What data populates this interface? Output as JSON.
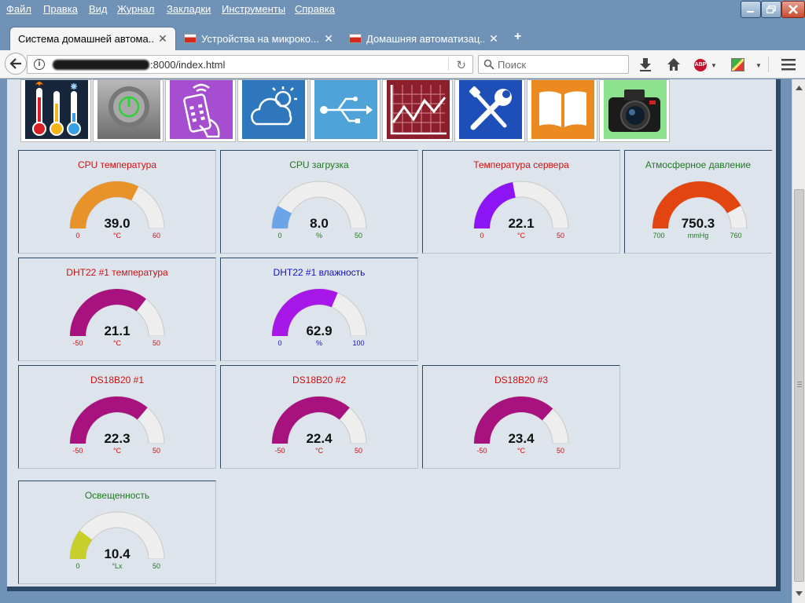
{
  "menubar": {
    "items": [
      "Файл",
      "Правка",
      "Вид",
      "Журнал",
      "Закладки",
      "Инструменты",
      "Справка"
    ]
  },
  "tabs": [
    {
      "label": "Система домашней автома...",
      "active": true
    },
    {
      "label": "Устройства на микроко...",
      "active": false
    },
    {
      "label": "Домашняя автоматизац...",
      "active": false
    }
  ],
  "tab_controls": {
    "close": "✕",
    "new_tab": "+"
  },
  "navbar": {
    "url_suffix": ":8000/index.html",
    "search_placeholder": "Поиск",
    "adblock_label": "ABP"
  },
  "app_tiles": [
    {
      "icon": "thermometers-icon"
    },
    {
      "icon": "power-button-icon"
    },
    {
      "icon": "remote-control-icon"
    },
    {
      "icon": "weather-icon"
    },
    {
      "icon": "usb-icon"
    },
    {
      "icon": "chart-icon"
    },
    {
      "icon": "tools-icon"
    },
    {
      "icon": "book-icon"
    },
    {
      "icon": "camera-icon"
    }
  ],
  "gauges": [
    {
      "title": "CPU температура",
      "value": 39.0,
      "display": "39.0",
      "unit": "°C",
      "min": 0,
      "max": 60,
      "min_label": "0",
      "max_label": "60",
      "fill": "#e8922a",
      "title_color": "#cc1111",
      "label_color": "#cc1111"
    },
    {
      "title": "CPU загрузка",
      "value": 8.0,
      "display": "8.0",
      "unit": "%",
      "min": 0,
      "max": 50,
      "min_label": "0",
      "max_label": "50",
      "fill": "#6ba4e8",
      "title_color": "#227722",
      "label_color": "#227722"
    },
    {
      "title": "Температура сервера",
      "value": 22.1,
      "display": "22.1",
      "unit": "°C",
      "min": 0,
      "max": 50,
      "min_label": "0",
      "max_label": "50",
      "fill": "#8c14f5",
      "title_color": "#cc1111",
      "label_color": "#cc1111"
    },
    {
      "title": "Атмосферное давление",
      "value": 750.3,
      "display": "750.3",
      "unit": "mmHg",
      "min": 700,
      "max": 760,
      "min_label": "700",
      "max_label": "760",
      "fill": "#e2450f",
      "title_color": "#227722",
      "label_color": "#227722"
    },
    {
      "title": "DHT22 #1 температура",
      "value": 21.1,
      "display": "21.1",
      "unit": "°C",
      "min": -50,
      "max": 50,
      "min_label": "-50",
      "max_label": "50",
      "fill": "#a8127e",
      "title_color": "#cc1111",
      "label_color": "#cc1111"
    },
    {
      "title": "DHT22 #1 влажность",
      "value": 62.9,
      "display": "62.9",
      "unit": "%",
      "min": 0,
      "max": 100,
      "min_label": "0",
      "max_label": "100",
      "fill": "#a617e8",
      "title_color": "#1111cc",
      "label_color": "#1111cc"
    },
    {
      "title": "DS18B20 #1",
      "value": 22.3,
      "display": "22.3",
      "unit": "°C",
      "min": -50,
      "max": 50,
      "min_label": "-50",
      "max_label": "50",
      "fill": "#a8127e",
      "title_color": "#cc1111",
      "label_color": "#cc1111"
    },
    {
      "title": "DS18B20 #2",
      "value": 22.4,
      "display": "22.4",
      "unit": "°C",
      "min": -50,
      "max": 50,
      "min_label": "-50",
      "max_label": "50",
      "fill": "#a8127e",
      "title_color": "#cc1111",
      "label_color": "#cc1111"
    },
    {
      "title": "DS18B20 #3",
      "value": 23.4,
      "display": "23.4",
      "unit": "°C",
      "min": -50,
      "max": 50,
      "min_label": "-50",
      "max_label": "50",
      "fill": "#a8127e",
      "title_color": "#cc1111",
      "label_color": "#cc1111"
    },
    {
      "title": "Освещенность",
      "value": 10.4,
      "display": "10.4",
      "unit": "°Lx",
      "min": 0,
      "max": 50,
      "min_label": "0",
      "max_label": "50",
      "fill": "#c9cf2a",
      "title_color": "#227722",
      "label_color": "#227722"
    }
  ]
}
